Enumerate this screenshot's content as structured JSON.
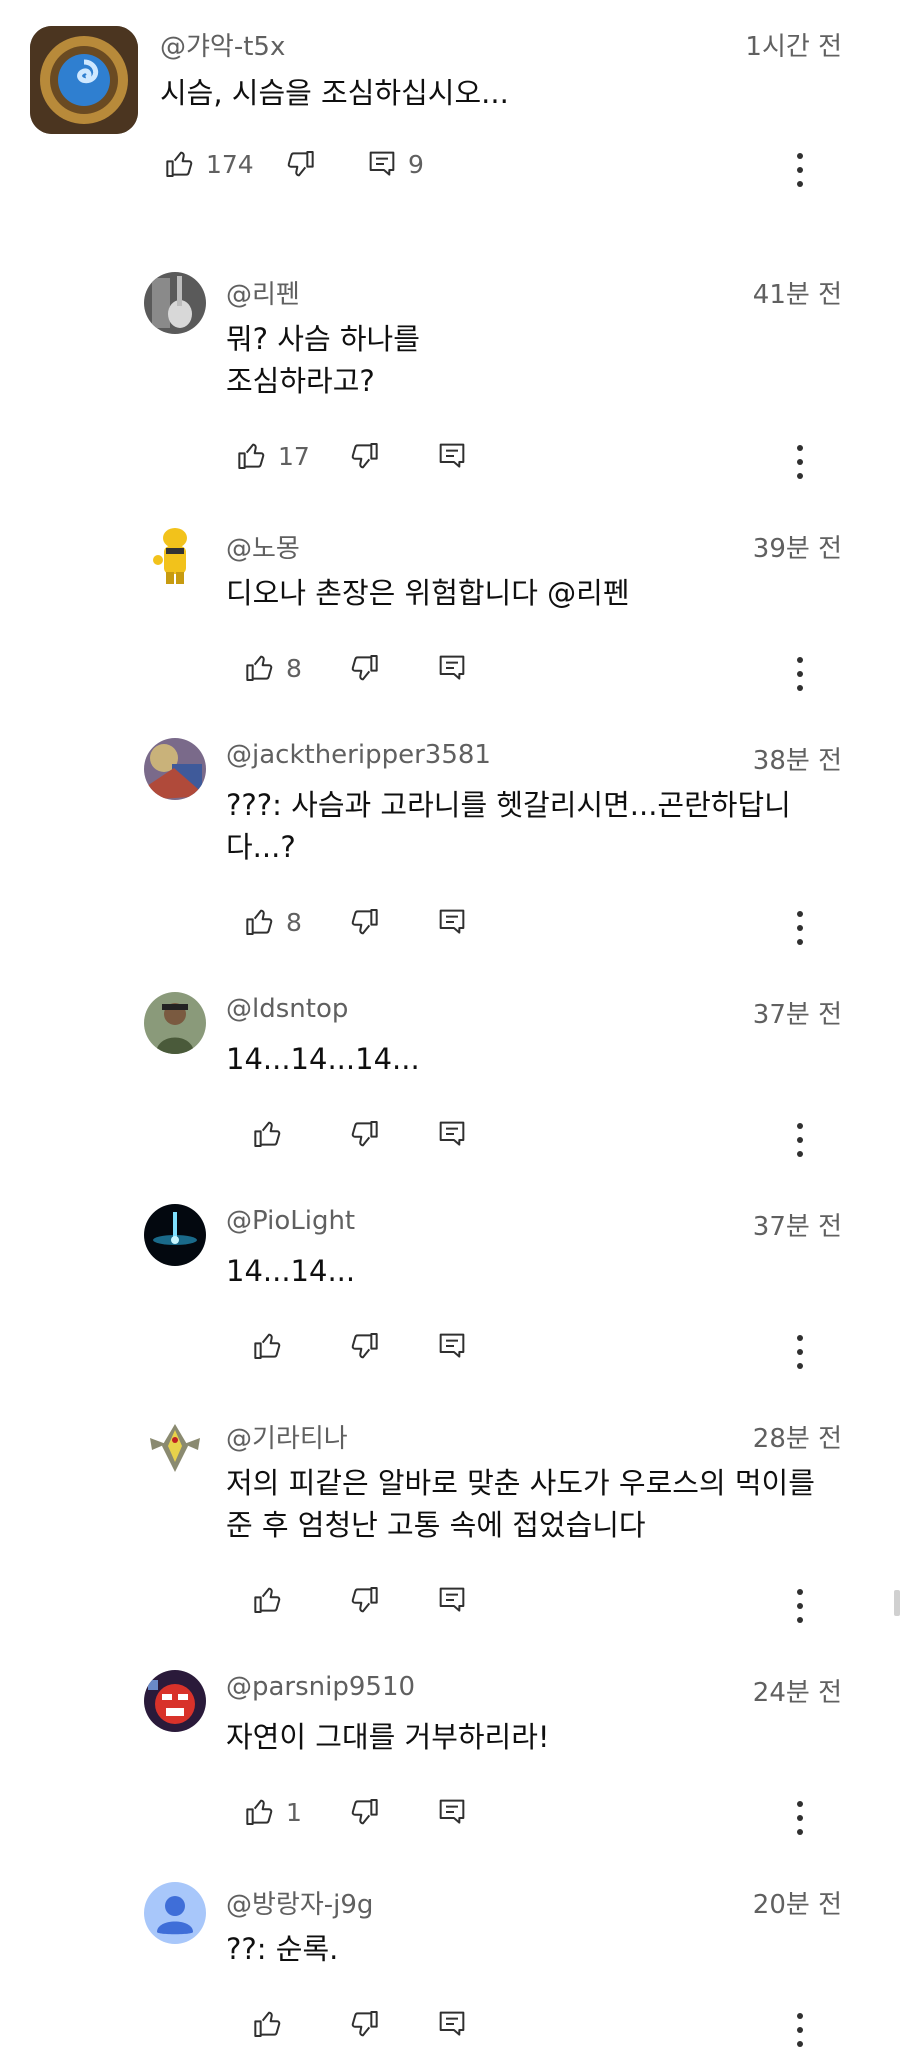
{
  "comments": [
    {
      "author": "@갸악-t5x",
      "time": "1시간 전",
      "text": "시슴, 시슴을 조심하십시오...",
      "likes": "174",
      "replies": "9"
    },
    {
      "author": "@리펜",
      "time": "41분 전",
      "text": "뭐? 사슴 하나를\n조심하라고?",
      "likes": "17"
    },
    {
      "author": "@노몽",
      "time": "39분 전",
      "text": "디오나 촌장은 위험합니다 @리펜",
      "likes": "8"
    },
    {
      "author": "@jacktheripper3581",
      "time": "38분 전",
      "text": "???: 사슴과 고라니를 헷갈리시면...곤란하답니\n다...?",
      "likes": "8"
    },
    {
      "author": "@ldsntop",
      "time": "37분 전",
      "text": "14...14...14...",
      "likes": ""
    },
    {
      "author": "@PioLight",
      "time": "37분 전",
      "text": "14...14...",
      "likes": ""
    },
    {
      "author": "@기라티나",
      "time": "28분 전",
      "text": "저의 피같은 알바로 맞춘 사도가 우로스의 먹이를\n준 후 엄청난 고통 속에 접었습니다",
      "likes": ""
    },
    {
      "author": "@parsnip9510",
      "time": "24분 전",
      "text": "자연이 그대를 거부하리라!",
      "likes": "1"
    },
    {
      "author": "@방랑자-j9g",
      "time": "20분 전",
      "text": "??: 순록.",
      "likes": ""
    }
  ]
}
